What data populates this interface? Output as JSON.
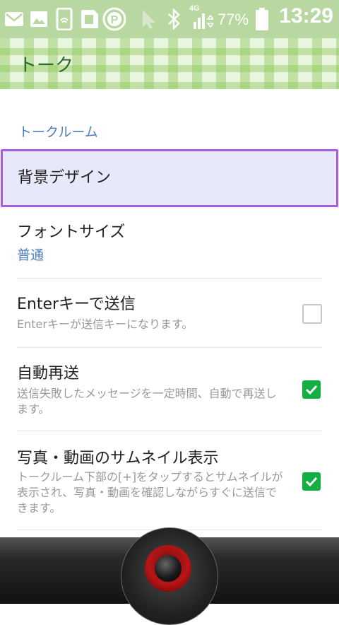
{
  "statusbar": {
    "time": "13:29",
    "battery_percent": "77%",
    "network": "4G",
    "icons": [
      "mail-icon",
      "image-icon",
      "nfc-icon",
      "sd-icon",
      "p-icon",
      "cursor-icon",
      "bluetooth-icon",
      "signal-icon",
      "battery-icon"
    ]
  },
  "header": {
    "title": "トーク"
  },
  "section": {
    "title": "トークルーム"
  },
  "items": [
    {
      "title": "背景デザイン"
    },
    {
      "title": "フォントサイズ",
      "value": "普通"
    },
    {
      "title": "Enterキーで送信",
      "subtitle": "Enterキーが送信キーになります。",
      "checked": false
    },
    {
      "title": "自動再送",
      "subtitle": "送信失敗したメッセージを一定時間、自動で再送します。",
      "checked": true
    },
    {
      "title": "写真・動画のサムネイル表示",
      "subtitle": "トークルーム下部の[+]をタップするとサムネイルが表示され、写真・動画を確認しながらすぐに送信できます。",
      "checked": true
    }
  ],
  "colors": {
    "accent": "#4f7fc0",
    "selection_border": "#a95de0",
    "checkbox_on": "#12b043",
    "header_text": "#2c6b2c"
  }
}
